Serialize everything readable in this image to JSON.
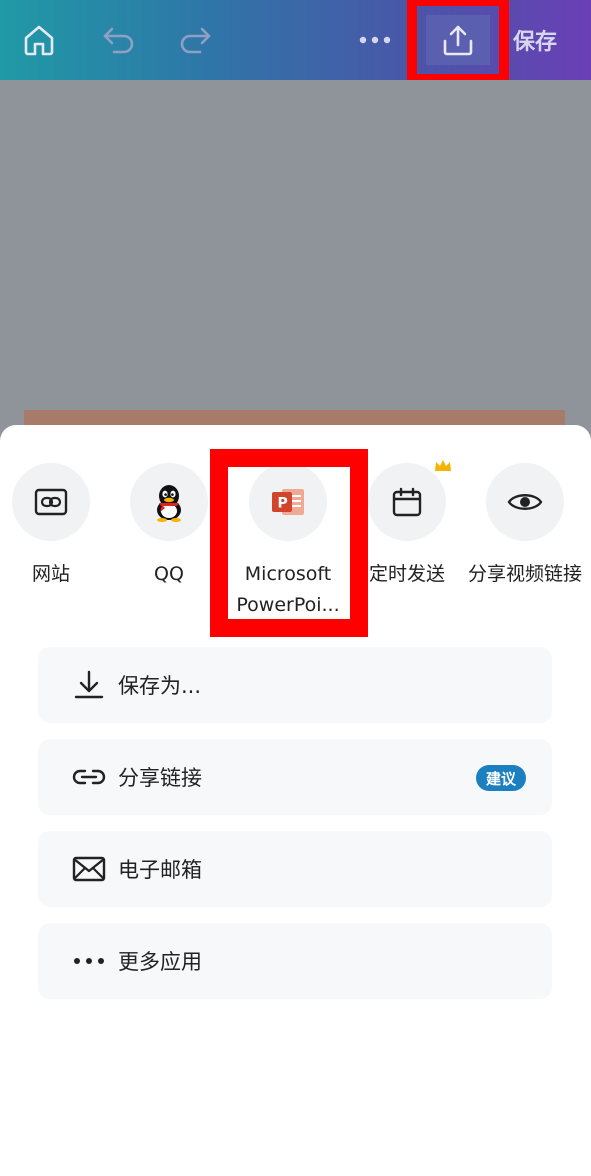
{
  "toolbar": {
    "save_label": "保存"
  },
  "apps": [
    {
      "label": "网站",
      "icon": "website-link-icon"
    },
    {
      "label": "QQ",
      "icon": "qq-penguin-icon"
    },
    {
      "label": "Microsoft PowerPoi...",
      "icon": "powerpoint-icon"
    },
    {
      "label": "定时发送",
      "icon": "calendar-icon"
    },
    {
      "label": "分享视频链接",
      "icon": "eye-icon"
    }
  ],
  "rows": [
    {
      "label": "保存为...",
      "icon": "download-icon"
    },
    {
      "label": "分享链接",
      "icon": "link-icon",
      "badge": "建议"
    },
    {
      "label": "电子邮箱",
      "icon": "mail-icon"
    },
    {
      "label": "更多应用",
      "icon": "more-dots-icon"
    }
  ],
  "colors": {
    "highlight": "#ff0000",
    "badge": "#1b7fc0",
    "powerpoint": "#d0452c"
  }
}
